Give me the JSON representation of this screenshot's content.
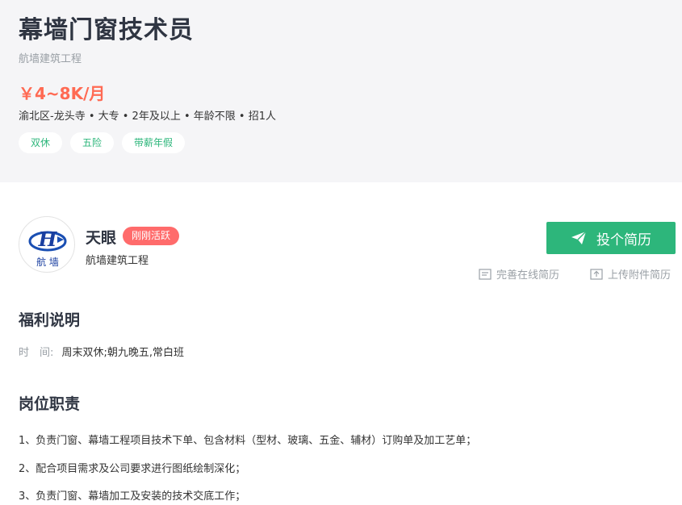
{
  "job": {
    "title": "幕墙门窗技术员",
    "company": "航墙建筑工程",
    "salary": "￥4~8K/月",
    "meta": "渝北区-龙头寺 • 大专 • 2年及以上  • 年龄不限 • 招1人",
    "tags": [
      "双休",
      "五险",
      "带薪年假"
    ]
  },
  "company_card": {
    "name": "天眼",
    "badge": "刚刚活跃",
    "company": "航墙建筑工程",
    "logo_text": "航  墙"
  },
  "actions": {
    "apply_label": "投个简历",
    "online_resume_label": "完善在线简历",
    "upload_resume_label": "上传附件简历"
  },
  "benefits": {
    "title": "福利说明",
    "time_label": "时　间:",
    "time_value": "周末双休;朝九晚五,常白班"
  },
  "duties": {
    "title": "岗位职责",
    "items": [
      "1、负责门窗、幕墙工程项目技术下单、包含材料（型材、玻璃、五金、辅材）订购单及加工艺单；",
      "2、配合项目需求及公司要求进行图纸绘制深化；",
      "3、负责门窗、幕墙加工及安装的技术交底工作；"
    ]
  },
  "colors": {
    "accent": "#2db67b",
    "salary": "#ff6a53",
    "badge": "#ff6b6b",
    "header_bg": "#f5f5f7"
  }
}
